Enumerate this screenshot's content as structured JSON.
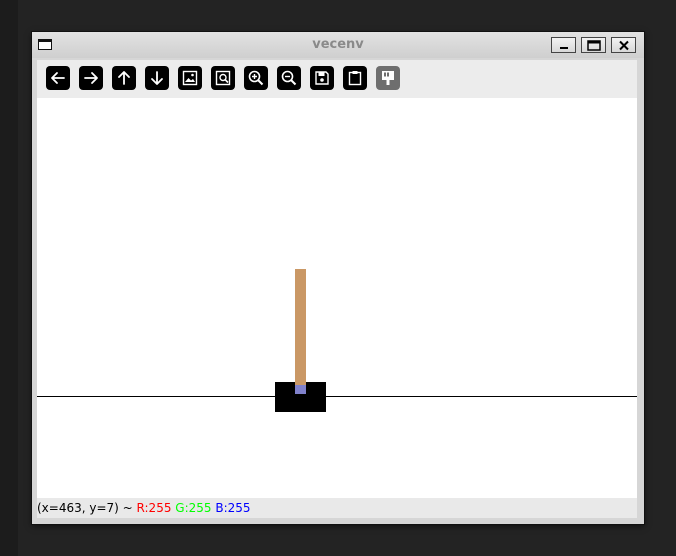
{
  "window": {
    "title": "vecenv"
  },
  "toolbar": {
    "buttons": [
      {
        "icon": "pan-left-icon"
      },
      {
        "icon": "pan-right-icon"
      },
      {
        "icon": "pan-up-icon"
      },
      {
        "icon": "pan-down-icon"
      },
      {
        "icon": "image-icon"
      },
      {
        "icon": "zoom-to-fit-icon"
      },
      {
        "icon": "zoom-in-icon"
      },
      {
        "icon": "zoom-out-icon"
      },
      {
        "icon": "save-icon"
      },
      {
        "icon": "clipboard-icon"
      },
      {
        "icon": "properties-icon"
      }
    ]
  },
  "status": {
    "coords": "(x=463, y=7) ~",
    "r": "R:255",
    "g": "G:255",
    "b": "B:255",
    "colors": {
      "r": "#ff0000",
      "g": "#00ff00",
      "b": "#0000ff"
    }
  },
  "scene": {
    "track_color": "#000000",
    "cart_color": "#000000",
    "pole_color": "#ca9865",
    "axle_color": "#8081cb"
  }
}
